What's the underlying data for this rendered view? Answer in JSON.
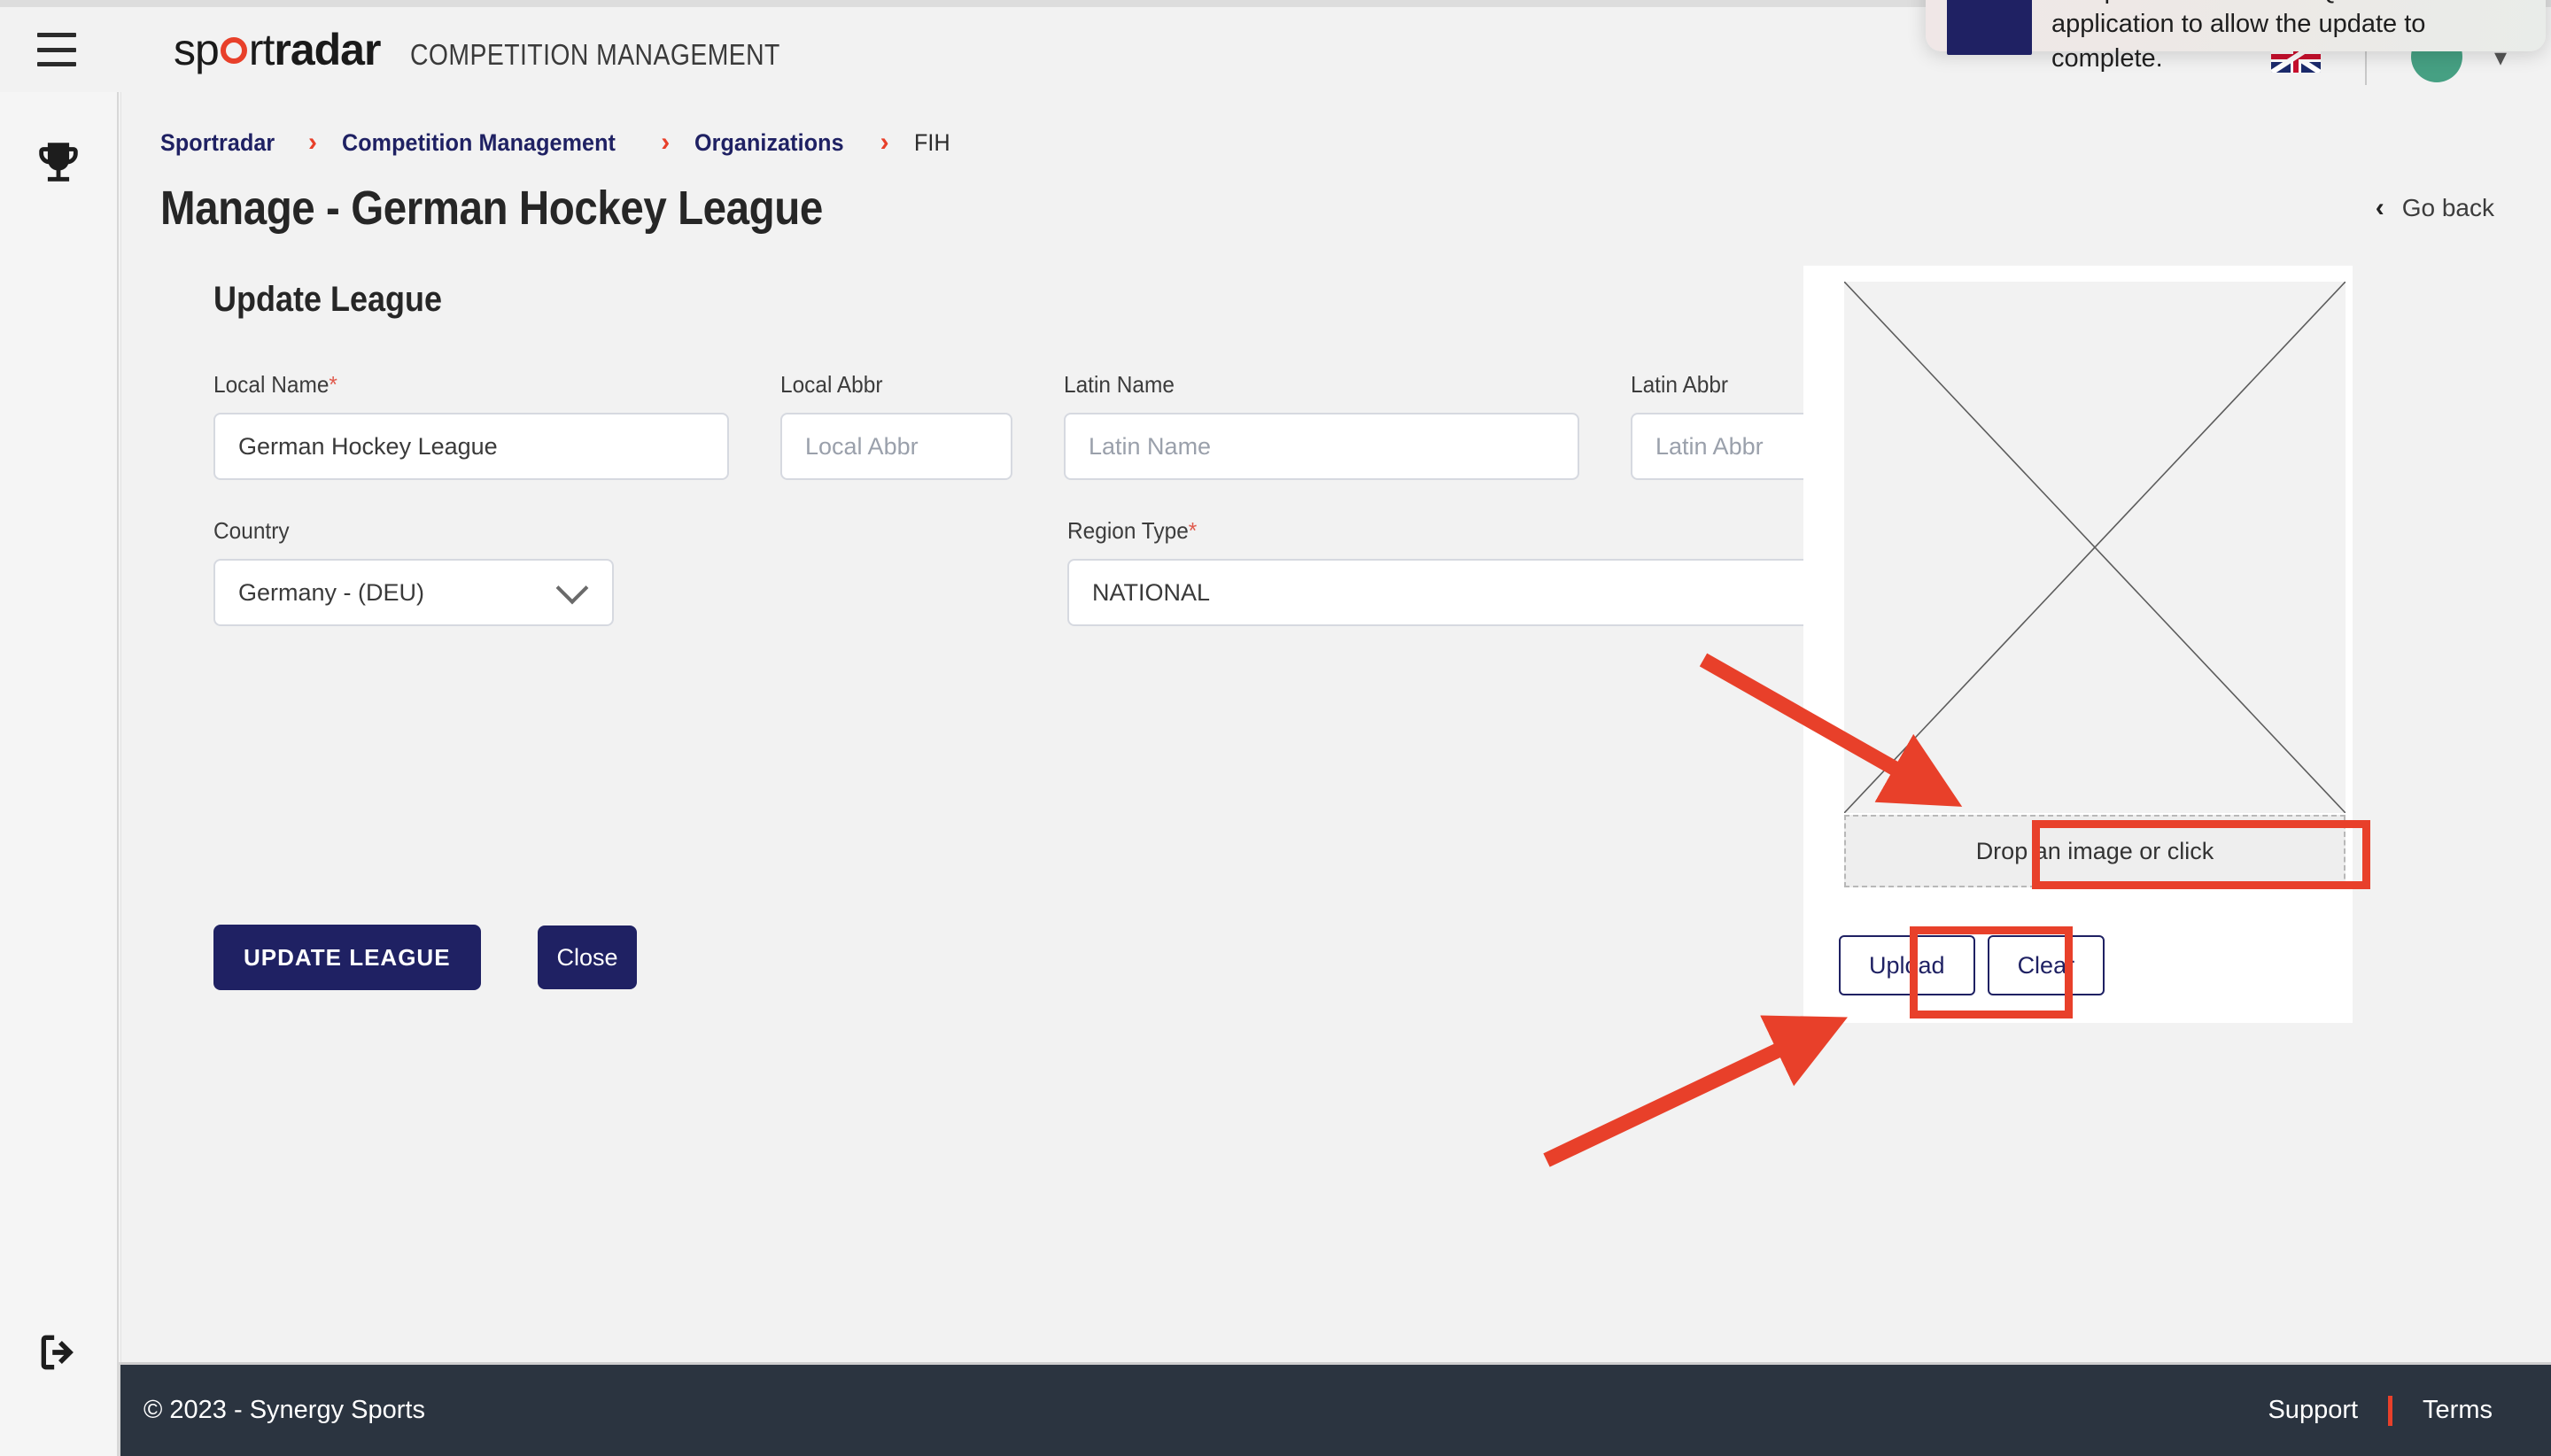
{
  "header": {
    "menu_icon": "hamburger-icon",
    "logo_part1": "sp",
    "logo_part2": "rt",
    "logo_part3": "radar",
    "app_title": "COMPETITION MANAGEMENT",
    "language_flag": "uk-flag-icon",
    "avatar": "user-avatar",
    "caret": "chevron-down-icon"
  },
  "toast": {
    "message": "An update is available. Quit this application to allow the update to complete.",
    "icon_color": "#1f2163"
  },
  "rail": {
    "top_icon": "trophy-icon",
    "bottom_icon": "logout-icon"
  },
  "breadcrumb": {
    "items": [
      {
        "label": "Sportradar"
      },
      {
        "label": "Competition Management"
      },
      {
        "label": "Organizations"
      },
      {
        "label": "FIH"
      }
    ],
    "separator": "›"
  },
  "page": {
    "title": "Manage - German Hockey League",
    "go_back": "Go back",
    "go_back_icon": "chevron-left-icon"
  },
  "form": {
    "section_title": "Update League",
    "fields": [
      {
        "label": "Local Name",
        "required": true,
        "value": "German Hockey League",
        "placeholder": "Local Name",
        "type": "text"
      },
      {
        "label": "Local Abbr",
        "required": false,
        "value": "",
        "placeholder": "Local Abbr",
        "type": "text"
      },
      {
        "label": "Latin Name",
        "required": false,
        "value": "",
        "placeholder": "Latin Name",
        "type": "text"
      },
      {
        "label": "Latin Abbr",
        "required": false,
        "value": "",
        "placeholder": "Latin Abbr",
        "type": "text"
      },
      {
        "label": "Country",
        "required": false,
        "value": "Germany - (DEU)",
        "placeholder": "Country",
        "type": "select"
      },
      {
        "label": "Region Type",
        "required": true,
        "value": "NATIONAL",
        "placeholder": "Region Type",
        "type": "select"
      }
    ],
    "submit_label": "UPDATE LEAGUE",
    "close_label": "Close"
  },
  "upload": {
    "image_state": "broken-image-placeholder",
    "dropzone_label": "Drop an image or click",
    "upload_label": "Upload",
    "clear_label": "Clear"
  },
  "annotations": {
    "color": "#e8402a",
    "boxes": [
      {
        "name": "dropzone-highlight"
      },
      {
        "name": "upload-button-highlight"
      }
    ],
    "arrows": [
      {
        "name": "arrow-to-dropzone"
      },
      {
        "name": "arrow-to-upload-button"
      }
    ]
  },
  "footer": {
    "copyright": "© 2023 - Synergy Sports",
    "support": "Support",
    "terms": "Terms",
    "separator_color": "#e8402a"
  }
}
